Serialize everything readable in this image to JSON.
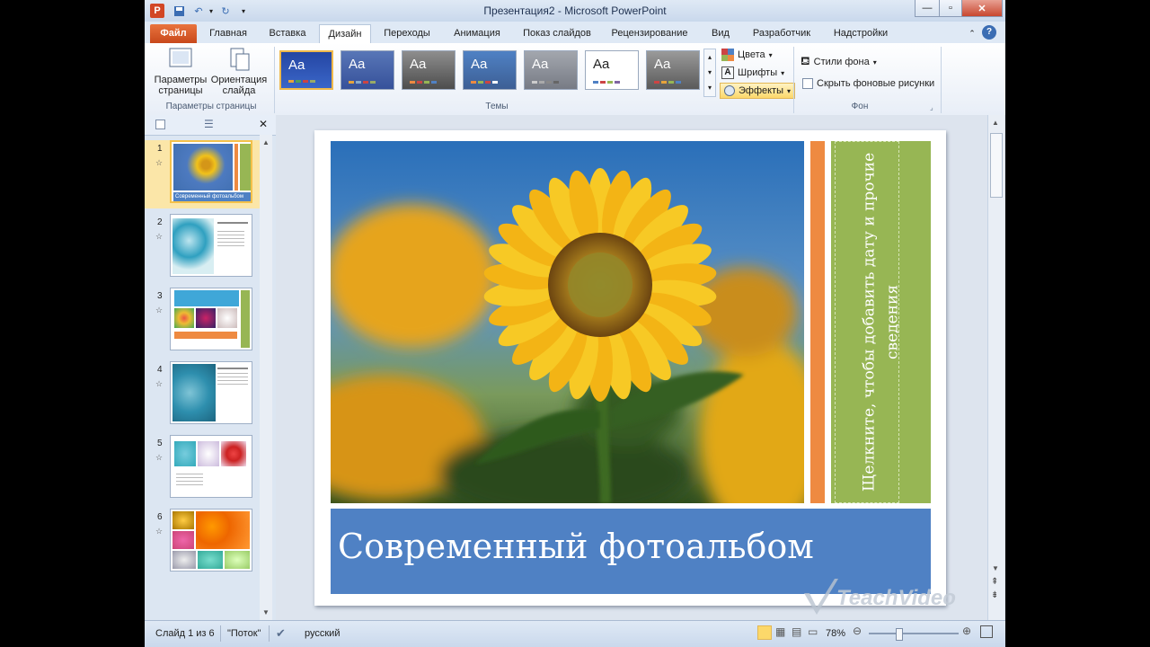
{
  "window": {
    "title": "Презентация2 - Microsoft PowerPoint",
    "app_icon": "P"
  },
  "tabs": [
    "Файл",
    "Главная",
    "Вставка",
    "Дизайн",
    "Переходы",
    "Анимация",
    "Показ слайдов",
    "Рецензирование",
    "Вид",
    "Разработчик",
    "Надстройки"
  ],
  "active_tab": "Дизайн",
  "ribbon": {
    "page_setup": {
      "setup_label": "Параметры\nстраницы",
      "orient_label": "Ориентация\nслайда",
      "group_label": "Параметры страницы"
    },
    "themes": {
      "group_label": "Темы",
      "sample_text": "Aa",
      "colors_label": "Цвета",
      "fonts_label": "Шрифты",
      "effects_label": "Эффекты"
    },
    "background": {
      "styles_label": "Стили фона",
      "hide_label": "Скрыть фоновые рисунки",
      "group_label": "Фон"
    }
  },
  "thumbnails": [
    {
      "num": "1",
      "caption": "Современный   фотоальбом"
    },
    {
      "num": "2"
    },
    {
      "num": "3"
    },
    {
      "num": "4"
    },
    {
      "num": "5"
    },
    {
      "num": "6"
    }
  ],
  "slide": {
    "title": "Современный фотоальбом",
    "side_text": "Щелкните, чтобы добавить дату и прочие сведения",
    "colors": {
      "orange": "#ee8a41",
      "green": "#97b654",
      "blue": "#4f81c4"
    }
  },
  "status": {
    "slide_info": "Слайд 1 из 6",
    "theme": "\"Поток\"",
    "language": "русский",
    "zoom": "78%"
  },
  "watermark": {
    "brand": "TeachVideo"
  }
}
